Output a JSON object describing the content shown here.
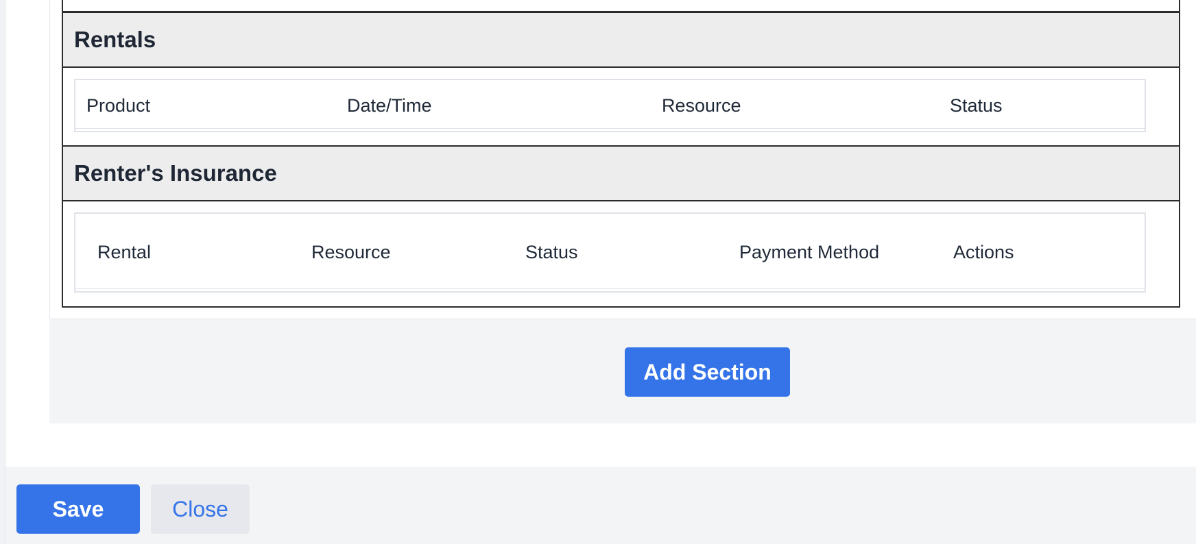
{
  "sections": [
    {
      "title": "Rentals",
      "columns": [
        "Product",
        "Date/Time",
        "Resource",
        "Status"
      ]
    },
    {
      "title": "Renter's Insurance",
      "columns": [
        "Rental",
        "Resource",
        "Status",
        "Payment Method",
        "Actions"
      ]
    }
  ],
  "add_section_label": "Add Section",
  "footer": {
    "save_label": "Save",
    "close_label": "Close"
  },
  "colors": {
    "primary": "#3574e8",
    "section_header_bg": "#ededee",
    "footer_bg": "#f3f4f6"
  }
}
